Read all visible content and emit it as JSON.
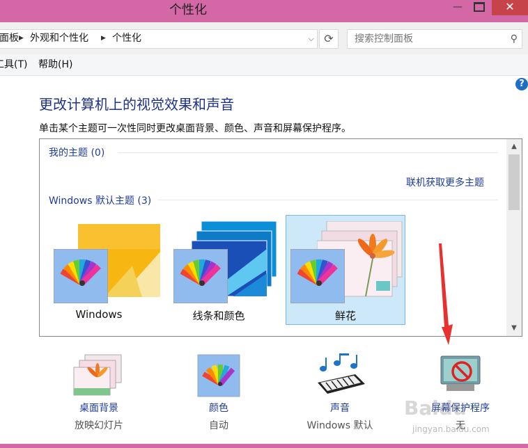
{
  "window": {
    "title": "个性化",
    "min": "—",
    "close": "✕"
  },
  "address": {
    "crumbs": [
      "面板",
      "外观和个性化",
      "个性化"
    ],
    "separator": "▶",
    "dropdown": "⌵",
    "refresh": "⟳"
  },
  "search": {
    "placeholder": "搜索控制面板",
    "icon": "⚲"
  },
  "menubar": {
    "items": [
      "工具(T)",
      "帮助(H)"
    ]
  },
  "help": "?",
  "main": {
    "heading": "更改计算机上的视觉效果和声音",
    "description": "单击某个主题可一次性同时更改桌面背景、颜色、声音和屏幕保护程序。"
  },
  "themes": {
    "my_group": "我的主题 (0)",
    "online_link": "联机获取更多主题",
    "default_group": "Windows 默认主题 (3)",
    "items": [
      {
        "name": "Windows",
        "selected": false
      },
      {
        "name": "线条和颜色",
        "selected": false
      },
      {
        "name": "鲜花",
        "selected": true
      }
    ]
  },
  "bottom": {
    "items": [
      {
        "label": "桌面背景",
        "value": "放映幻灯片",
        "icon": "desktop-background-icon"
      },
      {
        "label": "颜色",
        "value": "自动",
        "icon": "color-palette-icon"
      },
      {
        "label": "声音",
        "value": "Windows 默认",
        "icon": "sound-icon"
      },
      {
        "label": "屏幕保护程序",
        "value": "无",
        "icon": "screensaver-icon"
      }
    ]
  },
  "watermark": {
    "text": "Baidu",
    "url": "jingyan.baidu.com"
  },
  "colors": {
    "titlebar": "#d468a6",
    "link": "#1e3c9a",
    "selection": "#cde8f8",
    "arrow": "#e8312f"
  }
}
